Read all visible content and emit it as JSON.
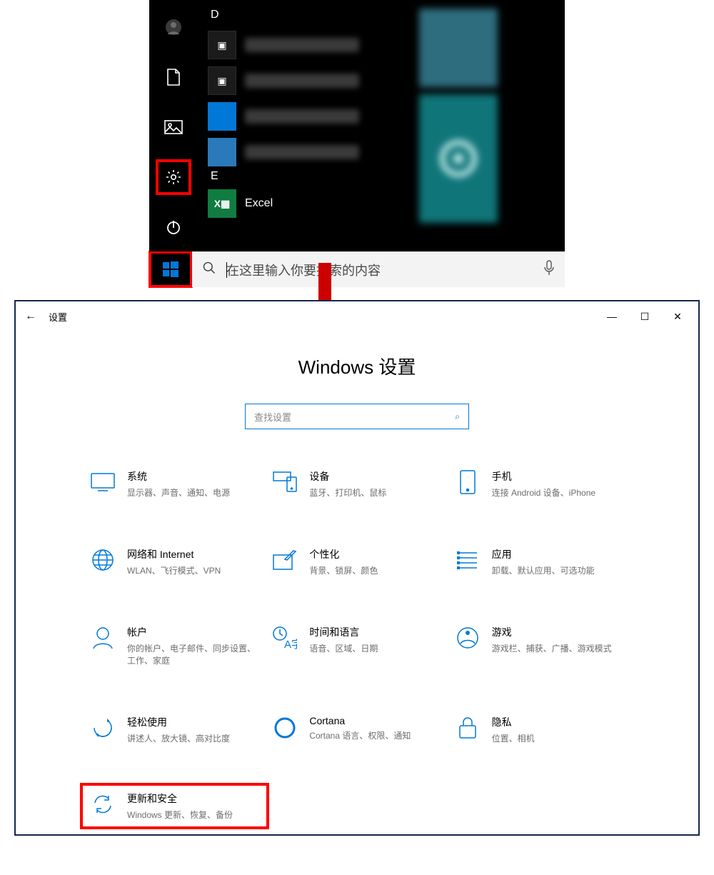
{
  "start_menu": {
    "section_letter_d": "D",
    "section_letter_e": "E",
    "excel_label": "Excel",
    "search_placeholder": "在这里输入你要搜索的内容"
  },
  "settings": {
    "title": "设置",
    "heading": "Windows 设置",
    "search_placeholder": "查找设置",
    "categories": [
      {
        "title": "系统",
        "desc": "显示器、声音、通知、电源"
      },
      {
        "title": "设备",
        "desc": "蓝牙、打印机、鼠标"
      },
      {
        "title": "手机",
        "desc": "连接 Android 设备、iPhone"
      },
      {
        "title": "网络和 Internet",
        "desc": "WLAN、飞行模式、VPN"
      },
      {
        "title": "个性化",
        "desc": "背景、锁屏、颜色"
      },
      {
        "title": "应用",
        "desc": "卸载、默认应用、可选功能"
      },
      {
        "title": "帐户",
        "desc": "你的帐户、电子邮件、同步设置、工作、家庭"
      },
      {
        "title": "时间和语言",
        "desc": "语音、区域、日期"
      },
      {
        "title": "游戏",
        "desc": "游戏栏、捕获、广播、游戏模式"
      },
      {
        "title": "轻松使用",
        "desc": "讲述人、放大镜、高对比度"
      },
      {
        "title": "Cortana",
        "desc": "Cortana 语言、权限、通知"
      },
      {
        "title": "隐私",
        "desc": "位置、相机"
      },
      {
        "title": "更新和安全",
        "desc": "Windows 更新、恢复、备份"
      }
    ]
  }
}
